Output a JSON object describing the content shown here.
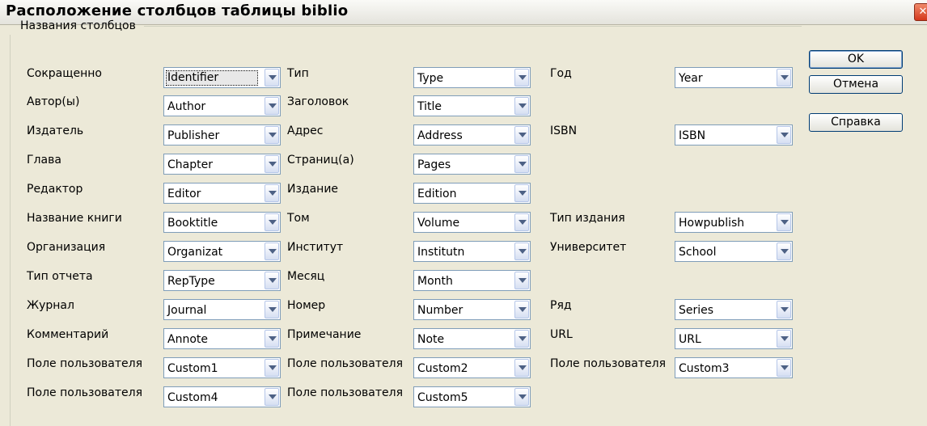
{
  "window": {
    "title": "Расположение столбцов таблицы biblio",
    "close_glyph": "✕"
  },
  "group": {
    "label": "Названия столбцов"
  },
  "columns": [
    [
      {
        "label": "Сокращенно",
        "value": "Identifier"
      },
      {
        "label": "Автор(ы)",
        "value": "Author"
      },
      {
        "label": "Издатель",
        "value": "Publisher"
      },
      {
        "label": "Глава",
        "value": "Chapter"
      },
      {
        "label": "Редактор",
        "value": "Editor"
      },
      {
        "label": "Название книги",
        "value": "Booktitle"
      },
      {
        "label": "Организация",
        "value": "Organizat"
      },
      {
        "label": "Тип отчета",
        "value": "RepType"
      },
      {
        "label": "Журнал",
        "value": "Journal"
      },
      {
        "label": "Комментарий",
        "value": "Annote"
      },
      {
        "label": "Поле пользователя",
        "value": "Custom1"
      },
      {
        "label": "Поле пользователя",
        "value": "Custom4"
      }
    ],
    [
      {
        "label": "Тип",
        "value": "Type"
      },
      {
        "label": "Заголовок",
        "value": "Title"
      },
      {
        "label": "Адрес",
        "value": "Address"
      },
      {
        "label": "Страниц(а)",
        "value": "Pages"
      },
      {
        "label": "Издание",
        "value": "Edition"
      },
      {
        "label": "Том",
        "value": "Volume"
      },
      {
        "label": "Институт",
        "value": "Institutn"
      },
      {
        "label": "Месяц",
        "value": "Month"
      },
      {
        "label": "Номер",
        "value": "Number"
      },
      {
        "label": "Примечание",
        "value": "Note"
      },
      {
        "label": "Поле пользователя",
        "value": "Custom2"
      },
      {
        "label": "Поле пользователя",
        "value": "Custom5"
      }
    ],
    [
      {
        "label": "Год",
        "value": "Year"
      },
      null,
      {
        "label": "ISBN",
        "value": "ISBN"
      },
      null,
      null,
      {
        "label": "Тип издания",
        "value": "Howpublish"
      },
      {
        "label": "Университет",
        "value": "School"
      },
      null,
      {
        "label": "Ряд",
        "value": "Series"
      },
      {
        "label": "URL",
        "value": "URL"
      },
      {
        "label": "Поле пользователя",
        "value": "Custom3"
      },
      null
    ]
  ],
  "buttons": {
    "ok": "OK",
    "cancel": "Отмена",
    "help": "Справка"
  }
}
